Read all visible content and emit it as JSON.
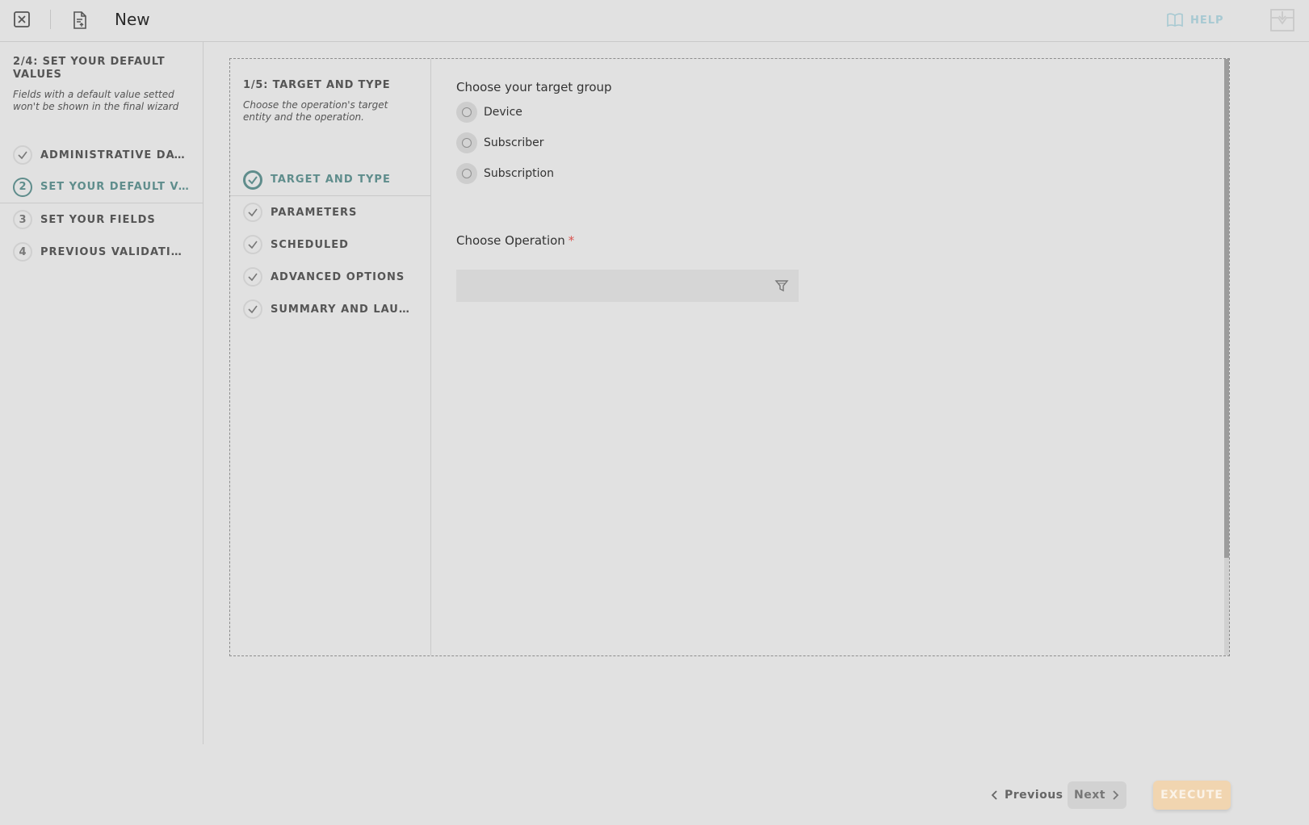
{
  "header": {
    "title": "New",
    "help_label": "HELP"
  },
  "sidebar": {
    "heading": "2/4: SET YOUR DEFAULT VALUES",
    "description": "Fields with a default value setted won't be shown in the final wizard",
    "steps": [
      {
        "marker": "",
        "label": "ADMINISTRATIVE DATA",
        "status": "done"
      },
      {
        "marker": "2",
        "label": "SET YOUR DEFAULT VALUES",
        "status": "active"
      },
      {
        "marker": "3",
        "label": "SET YOUR FIELDS",
        "status": "pending"
      },
      {
        "marker": "4",
        "label": "PREVIOUS VALIDATIONS",
        "status": "pending"
      }
    ]
  },
  "wizard": {
    "heading": "1/5: TARGET AND TYPE",
    "description": "Choose the operation's target entity and the operation.",
    "steps": [
      {
        "label": "TARGET AND TYPE",
        "status": "active"
      },
      {
        "label": "PARAMETERS",
        "status": "done"
      },
      {
        "label": "SCHEDULED",
        "status": "done"
      },
      {
        "label": "ADVANCED OPTIONS",
        "status": "done"
      },
      {
        "label": "SUMMARY AND LAUNCH",
        "status": "done"
      }
    ]
  },
  "form": {
    "target_group_label": "Choose your target group",
    "target_options": [
      "Device",
      "Subscriber",
      "Subscription"
    ],
    "operation_label": "Choose Operation",
    "operation_required_mark": "*",
    "operation_value": ""
  },
  "footer": {
    "previous_label": "Previous",
    "next_label": "Next",
    "execute_label": "EXECUTE"
  },
  "colors": {
    "accent": "#5f8d8c",
    "execute": "#f1d5b0",
    "help": "#a7c9d2"
  }
}
